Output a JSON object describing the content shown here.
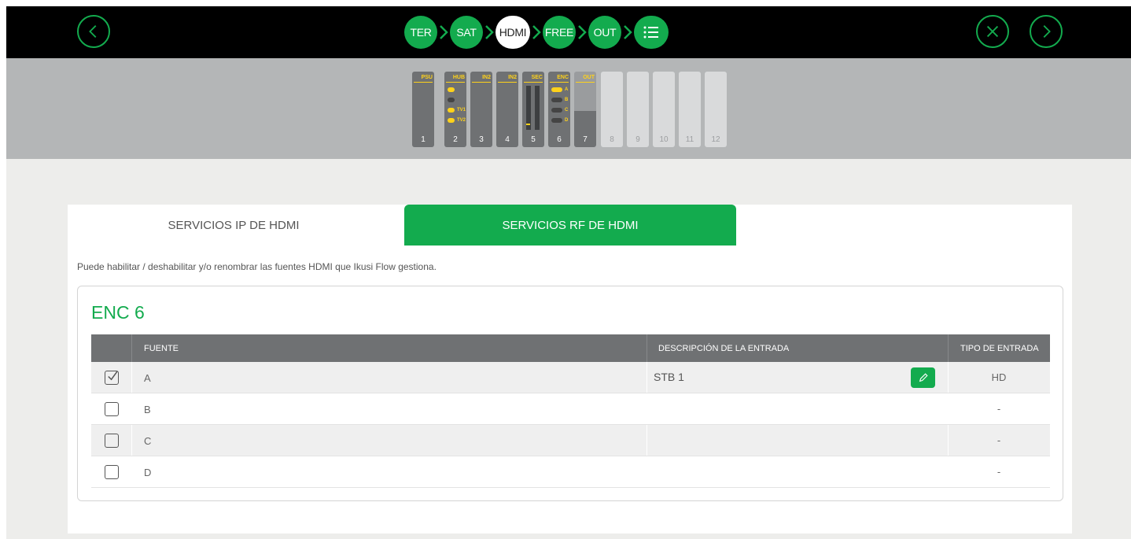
{
  "topbar": {
    "steps": [
      "TER",
      "SAT",
      "HDMI",
      "FREE",
      "OUT"
    ],
    "active_step": "HDMI",
    "icons": {
      "back": "chevron-left-icon",
      "close": "close-icon",
      "next": "chevron-right-icon",
      "list": "list-icon"
    }
  },
  "rack": {
    "modules": [
      {
        "label": "PSU",
        "num": "1"
      },
      {
        "label": "HUB",
        "num": "2",
        "ports": [
          "",
          "",
          "TV1",
          "TV2"
        ]
      },
      {
        "label": "IN2",
        "num": "3"
      },
      {
        "label": "IN2",
        "num": "4"
      },
      {
        "label": "SEC",
        "num": "5"
      },
      {
        "label": "ENC",
        "num": "6",
        "ports": [
          "A",
          "B",
          "C",
          "D"
        ]
      },
      {
        "label": "OUT",
        "num": "7"
      },
      {
        "label": "",
        "num": "8"
      },
      {
        "label": "",
        "num": "9"
      },
      {
        "label": "",
        "num": "10"
      },
      {
        "label": "",
        "num": "11"
      },
      {
        "label": "",
        "num": "12"
      }
    ]
  },
  "tabs": {
    "ip": "SERVICIOS IP DE HDMI",
    "rf": "SERVICIOS RF DE HDMI"
  },
  "info_text": "Puede habilitar / deshabilitar y/o renombrar las fuentes HDMI que Ikusi Flow gestiona.",
  "encoder": {
    "title": "ENC 6",
    "columns": {
      "source": "FUENTE",
      "description": "DESCRIPCIÓN DE LA ENTRADA",
      "type": "TIPO DE ENTRADA"
    },
    "rows": [
      {
        "source": "A",
        "description": "STB 1",
        "type": "HD",
        "checked": true
      },
      {
        "source": "B",
        "description": "",
        "type": "-",
        "checked": false
      },
      {
        "source": "C",
        "description": "",
        "type": "-",
        "checked": false
      },
      {
        "source": "D",
        "description": "",
        "type": "-",
        "checked": false
      }
    ]
  },
  "colors": {
    "accent": "#13ab4e",
    "rack_label": "#ffd21a"
  }
}
